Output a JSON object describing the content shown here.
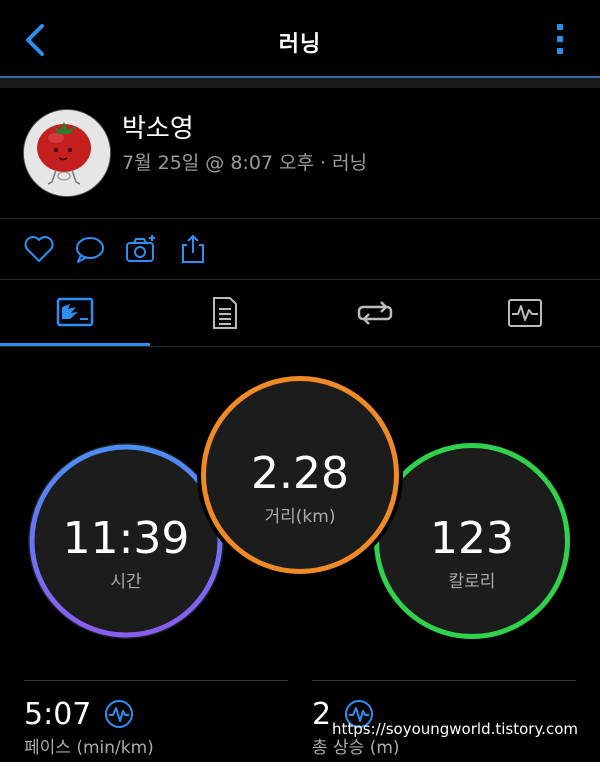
{
  "header": {
    "title": "러닝",
    "back_icon": "chevron-left-icon",
    "menu_icon": "kebab-menu-icon"
  },
  "profile": {
    "name": "박소영",
    "meta": "7월 25일 @ 8:07 오후 · 러닝"
  },
  "actions": [
    "heart-icon",
    "comment-icon",
    "camera-add-icon",
    "share-icon"
  ],
  "tabs": [
    {
      "icon": "stats-chart-icon",
      "active": true
    },
    {
      "icon": "document-list-icon",
      "active": false
    },
    {
      "icon": "laps-repeat-icon",
      "active": false
    },
    {
      "icon": "activity-graph-icon",
      "active": false
    }
  ],
  "metrics": {
    "time": {
      "value": "11:39",
      "label": "시간"
    },
    "distance": {
      "value": "2.28",
      "label": "거리(km)"
    },
    "calories": {
      "value": "123",
      "label": "칼로리"
    }
  },
  "stats": [
    {
      "value": "5:07",
      "label": "페이스 (min/km)"
    },
    {
      "value": "2",
      "label": "총 상승 (m)"
    }
  ],
  "watermark": "https://soyoungworld.tistory.com",
  "colors": {
    "accent": "#2e8ff2",
    "time_ring_start": "#4a8df6",
    "time_ring_end": "#8a5cf0",
    "distance_ring": "#f08a24",
    "calories_ring": "#2fd24a"
  }
}
